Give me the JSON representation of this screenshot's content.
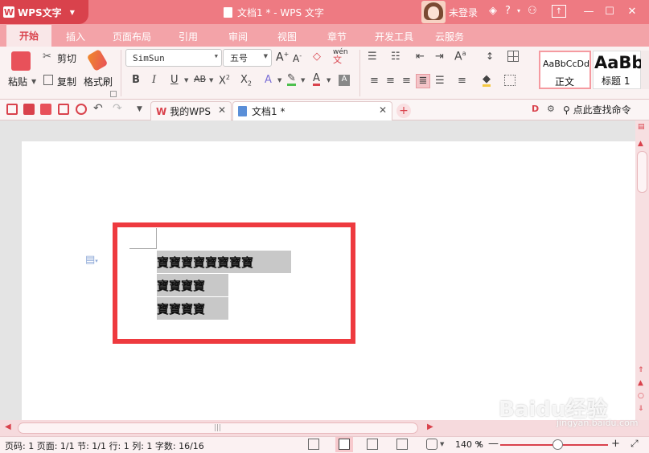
{
  "titlebar": {
    "app_name": "WPS文字",
    "doc_title": "文档1 * - WPS 文字",
    "login": "未登录"
  },
  "ribbon_tabs": [
    "开始",
    "插入",
    "页面布局",
    "引用",
    "审阅",
    "视图",
    "章节",
    "开发工具",
    "云服务"
  ],
  "ribbon": {
    "paste": "粘贴",
    "cut": "剪切",
    "copy": "复制",
    "format_painter": "格式刷",
    "font_name": "SimSun",
    "font_size": "五号",
    "styles": [
      {
        "sample": "AaBbCcDd",
        "name": "正文"
      },
      {
        "sample": "AaBb",
        "name": "标题 1"
      }
    ]
  },
  "doc_tabs": [
    {
      "label": "我的WPS"
    },
    {
      "label": "文档1 *"
    }
  ],
  "find_command": "点此查找命令",
  "document": {
    "lines": [
      "寶寶寶寶寶寶寶寶",
      "寶寶寶寶",
      "寶寶寶寶"
    ]
  },
  "status": {
    "text": "页码: 1  页面: 1/1  节: 1/1  行: 1  列: 1  字数: 16/16",
    "zoom": "140 %"
  },
  "watermark": {
    "brand": "Baidu经验",
    "url": "jingyan.baidu.com"
  },
  "colors": {
    "accent": "#d9424c",
    "highlight_box": "#ee3a3f",
    "selection": "#c8c8c8"
  }
}
